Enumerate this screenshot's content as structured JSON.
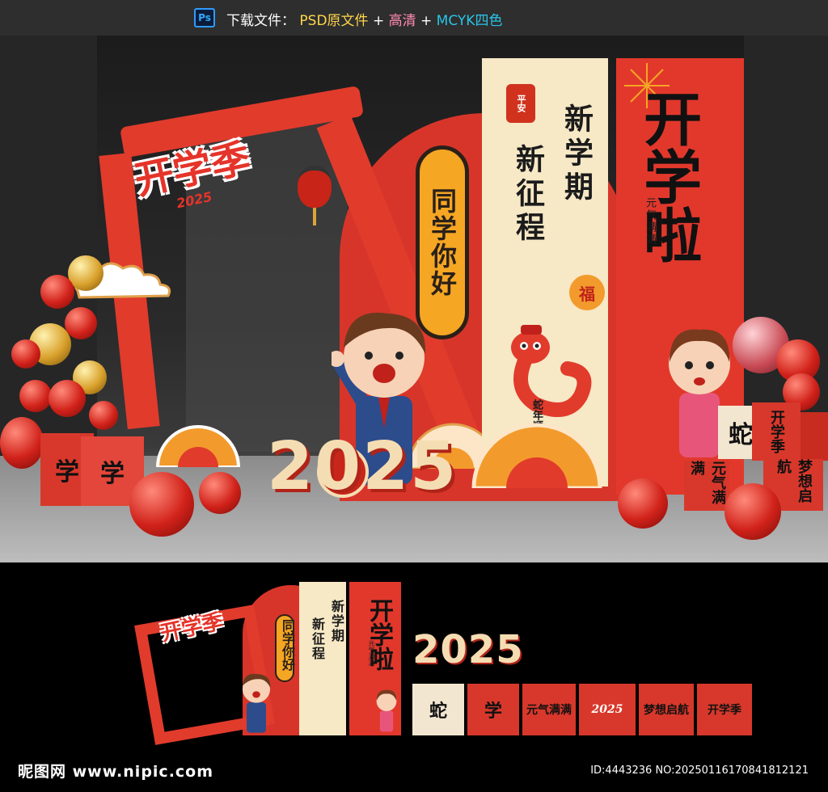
{
  "header": {
    "app_badge": "Ps",
    "label": "下载文件：",
    "psd": "PSD原文件",
    "plus1": "+",
    "hd": "高清",
    "plus2": "+",
    "cmyk": "MCYK四色"
  },
  "scene": {
    "arch_title": "开学季",
    "arch_year": "2025",
    "pill_text": "同学你好",
    "seal": "平安",
    "cream_line1": "新学期",
    "cream_line2": "新征程",
    "fu": "福",
    "snake_badge": "蛇年顺遂",
    "main_title": "开学啦",
    "main_sub": "元气满满",
    "big_year": "2025",
    "box_left1": "学",
    "box_left2": "学",
    "box_snake": "蛇",
    "box_kxj": "开学季",
    "box_yqmm": "元气满满",
    "box_mx": "梦想启航"
  },
  "preview": {
    "arch_title": "开学季",
    "pill_text": "同学你好",
    "cream_line1": "新学期",
    "cream_line2": "新征程",
    "main_title": "开学啦",
    "main_sub": "元气满满",
    "year": "2025",
    "tiles": [
      "蛇",
      "学",
      "元气满满",
      "2025",
      "梦想启航",
      "开学季"
    ]
  },
  "footer": {
    "logo": "昵图网 www.nipic.com",
    "id": "ID:4443236 NO:20250116170841812121"
  },
  "colors": {
    "festive_red": "#e13b2c",
    "cream": "#f7e8c6",
    "gold": "#f5a623",
    "ps_blue": "#31a8ff"
  }
}
